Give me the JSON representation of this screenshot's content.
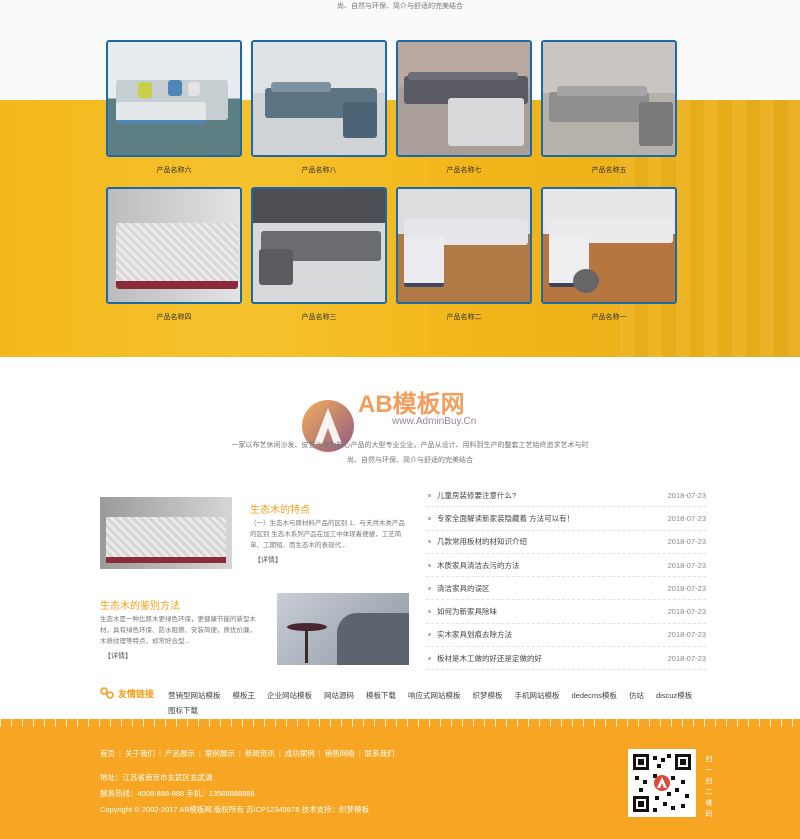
{
  "top_tagline": "尚、自然与环保、简介与舒适的完美结合",
  "products": [
    {
      "label": "产品名称六"
    },
    {
      "label": "产品名称八"
    },
    {
      "label": "产品名称七"
    },
    {
      "label": "产品名称五"
    },
    {
      "label": "产品名称四"
    },
    {
      "label": "产品名称三"
    },
    {
      "label": "产品名称二"
    },
    {
      "label": "产品名称一"
    }
  ],
  "watermark": {
    "brand": "AB模板网",
    "url": "www.AdminBuy.Cn"
  },
  "intro": {
    "line1": "一家以布艺休闲沙发、皮艺沙发为核心产品的大型专业企业。产品从设计、用料到生产的整套工艺始终追求艺术与时",
    "line2": "尚、自然与环保、简介与舒适的完美结合"
  },
  "feature_news": [
    {
      "title": "生态木的特点",
      "text": "（一）生态木与原材料产品的区别 1、与天然木类产品的区别 生态木系列产品在加工中体现着便捷，工艺简单、工期短、而生态木的表现代...",
      "more": "【详情】"
    },
    {
      "title": "生态木的鉴别方法",
      "text": "生态木是一种比原木更绿色环保，更健康节能的新型木材，具有绿色环保、防水阻燃、安装简便，质优价廉，木质纹理等特点，却常好合型...",
      "more": "【详情】"
    }
  ],
  "news_list": [
    {
      "title": "儿童房装修要注意什么?",
      "date": "2018-07-23"
    },
    {
      "title": "专家全面解读新家装隐藏着 方法可以有！",
      "date": "2018-07-23"
    },
    {
      "title": "几款常用板材的材知识介绍",
      "date": "2018-07-23"
    },
    {
      "title": "木质家具清洁去污的方法",
      "date": "2018-07-23"
    },
    {
      "title": "清洁家具的误区",
      "date": "2018-07-23"
    },
    {
      "title": "如何为新家具除味",
      "date": "2018-07-23"
    },
    {
      "title": "实木家具划痕去除方法",
      "date": "2018-07-23"
    },
    {
      "title": "板材是木工做的好还是定做的好",
      "date": "2018-07-23"
    }
  ],
  "links": {
    "heading": "友情链接",
    "items": [
      "营销型网站模板",
      "模板王",
      "企业网站模板",
      "网站源码",
      "模板下载",
      "响应式网站模板",
      "织梦模板",
      "手机网站模板",
      "dedecms模板",
      "仿站",
      "discuz模板",
      "图标下载"
    ]
  },
  "footer": {
    "nav": [
      "首页",
      "关于我们",
      "产品展示",
      "案例展示",
      "新闻资讯",
      "成功案例",
      "销售网络",
      "联系我们"
    ],
    "address": "地址：江苏省南京市玄武区玄武湖",
    "service": "服务热线：4008-888-888    手机：13588888888",
    "copyright": "Copyright © 2002-2017 AB模板网 版权所有  苏ICP12345678  技术支持：织梦模板",
    "qr_label": "扫一扫二维码"
  }
}
